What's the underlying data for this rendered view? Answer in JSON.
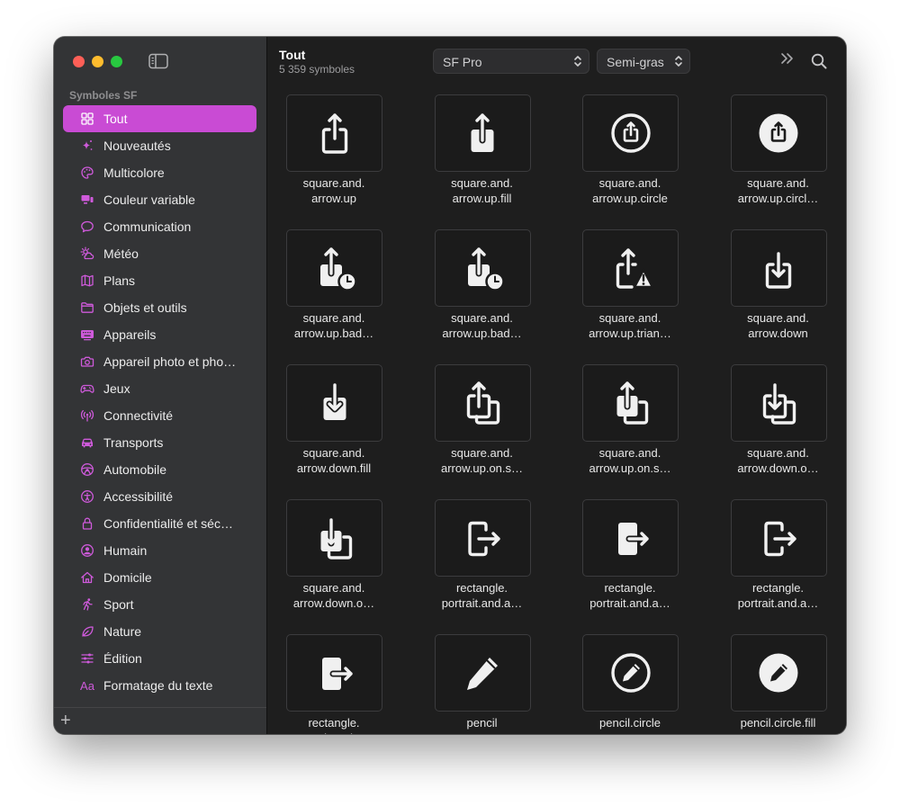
{
  "sidebar": {
    "section_title": "Symboles SF",
    "items": [
      {
        "label": "Tout",
        "icon": "grid-icon",
        "active": true
      },
      {
        "label": "Nouveautés",
        "icon": "sparkles-icon"
      },
      {
        "label": "Multicolore",
        "icon": "palette-icon"
      },
      {
        "label": "Couleur variable",
        "icon": "variable-color-icon"
      },
      {
        "label": "Communication",
        "icon": "message-icon"
      },
      {
        "label": "Météo",
        "icon": "sun-cloud-icon"
      },
      {
        "label": "Plans",
        "icon": "map-icon"
      },
      {
        "label": "Objets et outils",
        "icon": "folder-icon"
      },
      {
        "label": "Appareils",
        "icon": "keyboard-icon"
      },
      {
        "label": "Appareil photo et pho…",
        "icon": "camera-icon"
      },
      {
        "label": "Jeux",
        "icon": "gamecontroller-icon"
      },
      {
        "label": "Connectivité",
        "icon": "antenna-icon"
      },
      {
        "label": "Transports",
        "icon": "car-icon"
      },
      {
        "label": "Automobile",
        "icon": "steering-wheel-icon"
      },
      {
        "label": "Accessibilité",
        "icon": "accessibility-icon"
      },
      {
        "label": "Confidentialité et séc…",
        "icon": "lock-icon"
      },
      {
        "label": "Humain",
        "icon": "person-circle-icon"
      },
      {
        "label": "Domicile",
        "icon": "house-icon"
      },
      {
        "label": "Sport",
        "icon": "figure-run-icon"
      },
      {
        "label": "Nature",
        "icon": "leaf-icon"
      },
      {
        "label": "Édition",
        "icon": "sliders-icon"
      },
      {
        "label": "Formatage du texte",
        "icon": "textformat-icon",
        "icon_text": "Aa"
      }
    ],
    "add_label": "+"
  },
  "toolbar": {
    "title": "Tout",
    "subtitle": "5 359 symboles",
    "font_popup": "SF Pro",
    "weight_popup": "Semi-gras"
  },
  "symbols": [
    {
      "line1": "square.and.",
      "line2": "arrow.up",
      "icon": "square-and-arrow-up-icon"
    },
    {
      "line1": "square.and.",
      "line2": "arrow.up.fill",
      "icon": "square-and-arrow-up-fill-icon"
    },
    {
      "line1": "square.and.",
      "line2": "arrow.up.circle",
      "icon": "square-and-arrow-up-circle-icon"
    },
    {
      "line1": "square.and.",
      "line2": "arrow.up.circl…",
      "icon": "square-and-arrow-up-circle-fill-icon"
    },
    {
      "line1": "square.and.",
      "line2": "arrow.up.bad…",
      "icon": "square-and-arrow-up-badge-clock-icon"
    },
    {
      "line1": "square.and.",
      "line2": "arrow.up.bad…",
      "icon": "square-and-arrow-up-badge-clock-fill-icon"
    },
    {
      "line1": "square.and.",
      "line2": "arrow.up.trian…",
      "icon": "square-and-arrow-up-trianglebadge-icon"
    },
    {
      "line1": "square.and.",
      "line2": "arrow.down",
      "icon": "square-and-arrow-down-icon"
    },
    {
      "line1": "square.and.",
      "line2": "arrow.down.fill",
      "icon": "square-and-arrow-down-fill-icon"
    },
    {
      "line1": "square.and.",
      "line2": "arrow.up.on.s…",
      "icon": "square-and-arrow-up-on-square-icon"
    },
    {
      "line1": "square.and.",
      "line2": "arrow.up.on.s…",
      "icon": "square-and-arrow-up-on-square-fill-icon"
    },
    {
      "line1": "square.and.",
      "line2": "arrow.down.o…",
      "icon": "square-and-arrow-down-on-square-icon"
    },
    {
      "line1": "square.and.",
      "line2": "arrow.down.o…",
      "icon": "square-and-arrow-down-on-square-fill-icon"
    },
    {
      "line1": "rectangle.",
      "line2": "portrait.and.a…",
      "icon": "rectangle-portrait-and-arrow-right-icon"
    },
    {
      "line1": "rectangle.",
      "line2": "portrait.and.a…",
      "icon": "rectangle-portrait-and-arrow-right-fill-icon"
    },
    {
      "line1": "rectangle.",
      "line2": "portrait.and.a…",
      "icon": "rectangle-portrait-and-arrow-forward-icon"
    },
    {
      "line1": "rectangle.",
      "line2": "portrait.and.a…",
      "icon": "rectangle-portrait-and-arrow-forward-fill-icon"
    },
    {
      "line1": "pencil",
      "line2": "",
      "icon": "pencil-icon"
    },
    {
      "line1": "pencil.circle",
      "line2": "",
      "icon": "pencil-circle-icon"
    },
    {
      "line1": "pencil.circle.fill",
      "line2": "",
      "icon": "pencil-circle-fill-icon"
    }
  ]
}
